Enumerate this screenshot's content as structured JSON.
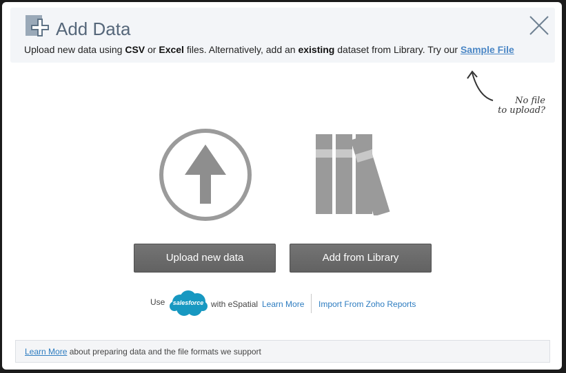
{
  "header": {
    "title": "Add Data",
    "subtitle": {
      "t1": "Upload new data using ",
      "b1": "CSV",
      "t2": " or ",
      "b2": "Excel",
      "t3": " files. Alternatively, add an ",
      "b3": "existing",
      "t4": " dataset from Library. Try our ",
      "link": "Sample File"
    }
  },
  "hint": {
    "line1": "No file",
    "line2": "to upload?"
  },
  "actions": {
    "upload_label": "Upload new data",
    "library_label": "Add from Library"
  },
  "salesforce": {
    "use": "Use",
    "logo_text": "salesforce",
    "with": "with eSpatial",
    "learn_more": "Learn More",
    "zoho": "Import From Zoho Reports"
  },
  "footer": {
    "link": "Learn More",
    "text": " about preparing data and the file formats we support"
  },
  "colors": {
    "title": "#56677a",
    "link": "#2d7cc0",
    "button": "#6b6b6b",
    "salesforce": "#1798c1"
  },
  "icons": [
    "add-data-icon",
    "close-icon",
    "upload-arrow-icon",
    "library-books-icon",
    "salesforce-logo",
    "hint-arrow-icon"
  ]
}
